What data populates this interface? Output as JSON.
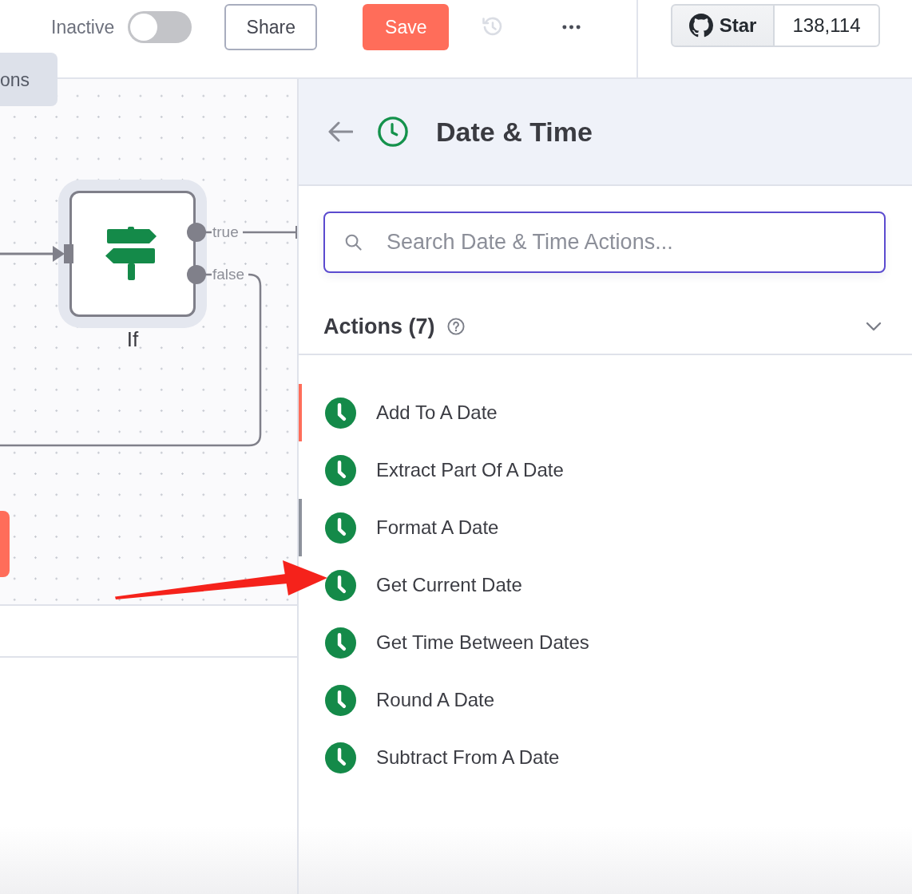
{
  "header": {
    "activation": {
      "label": "Inactive",
      "on": false
    },
    "share_button": "Share",
    "save_button": "Save",
    "history": {
      "disabled": true
    },
    "github": {
      "star_label": "Star",
      "count": "138,114"
    }
  },
  "canvas": {
    "tab": {
      "label": "ons"
    },
    "node": {
      "kind": "if",
      "label": "If",
      "selected": true,
      "outputs": [
        {
          "label": "true"
        },
        {
          "label": "false"
        }
      ]
    }
  },
  "panel": {
    "title": "Date & Time",
    "search": {
      "placeholder": "Search Date & Time Actions..."
    },
    "section": {
      "title": "Actions (7)",
      "expanded": true
    },
    "actions": [
      {
        "label": "Add To A Date",
        "selected": true,
        "hovered": false
      },
      {
        "label": "Extract Part Of A Date",
        "selected": false,
        "hovered": false
      },
      {
        "label": "Format A Date",
        "selected": false,
        "hovered": true
      },
      {
        "label": "Get Current Date",
        "selected": false,
        "hovered": false
      },
      {
        "label": "Get Time Between Dates",
        "selected": false,
        "hovered": false
      },
      {
        "label": "Round A Date",
        "selected": false,
        "hovered": false
      },
      {
        "label": "Subtract From A Date",
        "selected": false,
        "hovered": false
      }
    ]
  }
}
